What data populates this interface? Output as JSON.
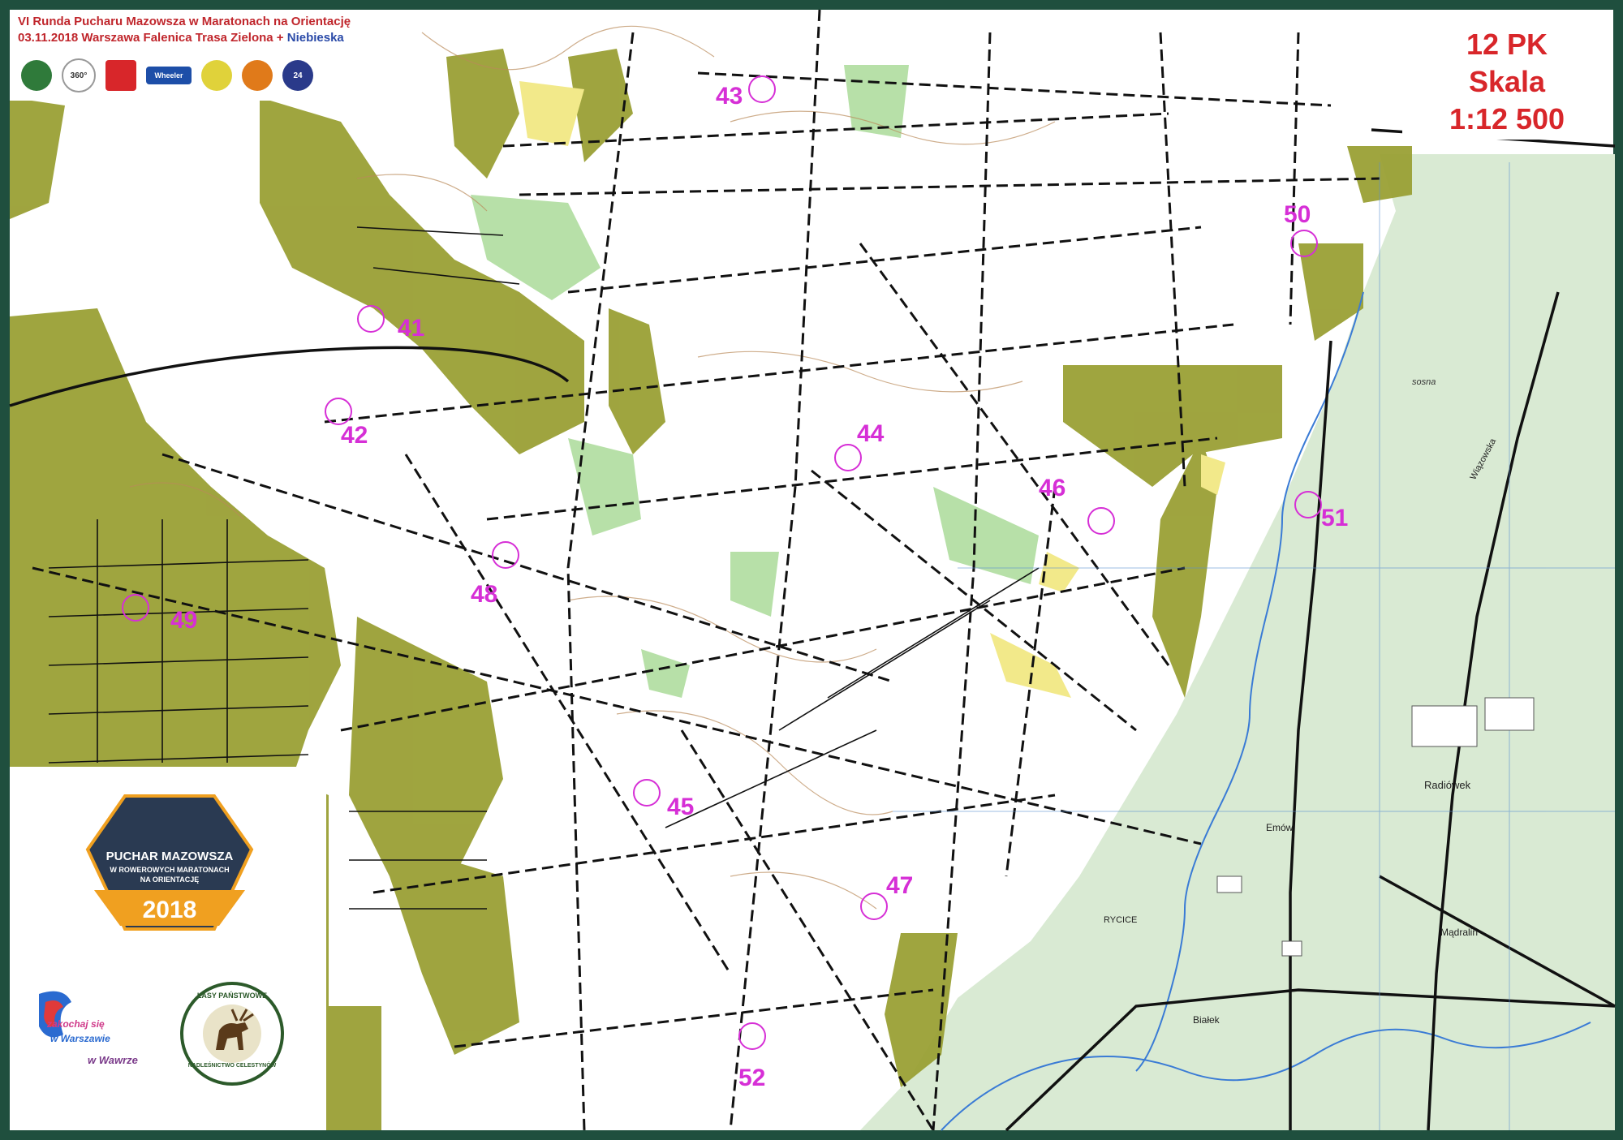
{
  "header": {
    "line1": "VI Runda Pucharu Mazowsza w Maratonach na Orientację",
    "line2_main": "03.11.2018 Warszawa Falenica Trasa Zielona + ",
    "line2_blue": "Niebieska",
    "sponsors": [
      "Lasy Państwowe logo",
      "360°",
      "Logo",
      "Wheeler",
      "Logo",
      "Logo",
      "24"
    ]
  },
  "scale": {
    "controls": "12 PK",
    "label": "Skala",
    "value": "1:12 500"
  },
  "badge": {
    "line1": "PUCHAR MAZOWSZA",
    "line2": "W ROWEROWYCH MARATONACH",
    "line3": "NA ORIENTACJĘ",
    "year": "2018"
  },
  "logos": {
    "lasy_top": "LASY PAŃSTWOWE",
    "lasy_bottom": "NADLEŚNICTWO CELESTYNÓW",
    "wawer_line1": "zakochaj się",
    "wawer_line2": "w Warszawie",
    "wawer_line3": "w Wawrze"
  },
  "checkpoints": [
    {
      "id": "41",
      "label": "41"
    },
    {
      "id": "42",
      "label": "42"
    },
    {
      "id": "43",
      "label": "43"
    },
    {
      "id": "44",
      "label": "44"
    },
    {
      "id": "45",
      "label": "45"
    },
    {
      "id": "46",
      "label": "46"
    },
    {
      "id": "47",
      "label": "47"
    },
    {
      "id": "48",
      "label": "48"
    },
    {
      "id": "49",
      "label": "49"
    },
    {
      "id": "50",
      "label": "50"
    },
    {
      "id": "51",
      "label": "51"
    },
    {
      "id": "52",
      "label": "52"
    }
  ],
  "place_names": {
    "radiowek": "Radiówek",
    "emow": "Emów",
    "madralin": "Mądralin",
    "bialek": "Białek",
    "rycice": "RYCICE",
    "sosna": "sosna",
    "wiazowska": "Wiązowska"
  },
  "colors": {
    "frame": "#1f4f3e",
    "control": "#d62fd6",
    "olive": "#9aa035",
    "green": "#b7e0a8",
    "yellow": "#f2e98a",
    "topo_green": "#d9ead3",
    "scale_red": "#d8262a"
  }
}
